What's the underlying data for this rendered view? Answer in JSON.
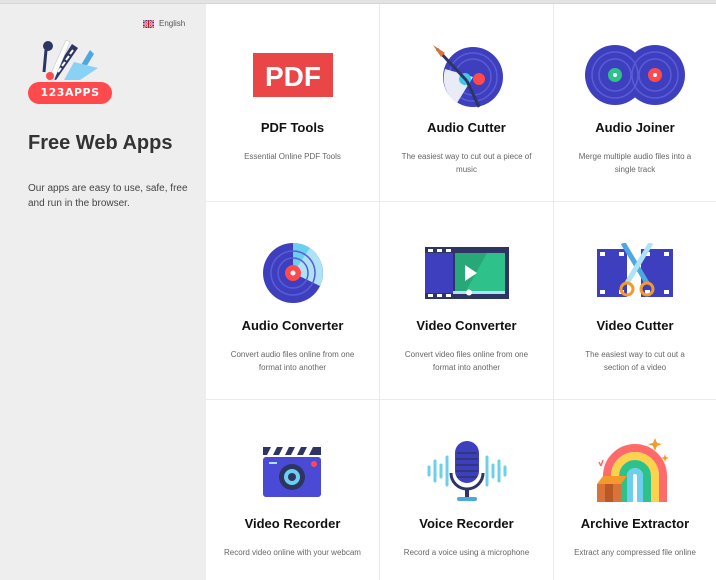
{
  "language": {
    "label": "English",
    "icon": "uk-flag-icon"
  },
  "brand": {
    "logo_text": "123APPS",
    "accent": "#ff4a4d"
  },
  "sidebar": {
    "title": "Free Web Apps",
    "description": "Our apps are easy to use, safe, free and run in the browser."
  },
  "apps": [
    {
      "title": "PDF Tools",
      "desc": "Essential Online PDF Tools",
      "icon": "pdf-icon",
      "icon_text": "PDF"
    },
    {
      "title": "Audio Cutter",
      "desc": "The easiest way to cut out a piece of music",
      "icon": "audio-cutter-icon"
    },
    {
      "title": "Audio Joiner",
      "desc": "Merge multiple audio files into a single track",
      "icon": "audio-joiner-icon"
    },
    {
      "title": "Audio Converter",
      "desc": "Convert audio files online from one format into another",
      "icon": "audio-converter-icon"
    },
    {
      "title": "Video Converter",
      "desc": "Convert video files online from one format into another",
      "icon": "video-converter-icon"
    },
    {
      "title": "Video Cutter",
      "desc": "The easiest way to cut out a section of a video",
      "icon": "video-cutter-icon"
    },
    {
      "title": "Video Recorder",
      "desc": "Record video online with your webcam",
      "icon": "video-recorder-icon"
    },
    {
      "title": "Voice Recorder",
      "desc": "Record a voice using a microphone",
      "icon": "voice-recorder-icon"
    },
    {
      "title": "Archive Extractor",
      "desc": "Extract any compressed file online",
      "icon": "archive-extractor-icon"
    }
  ]
}
